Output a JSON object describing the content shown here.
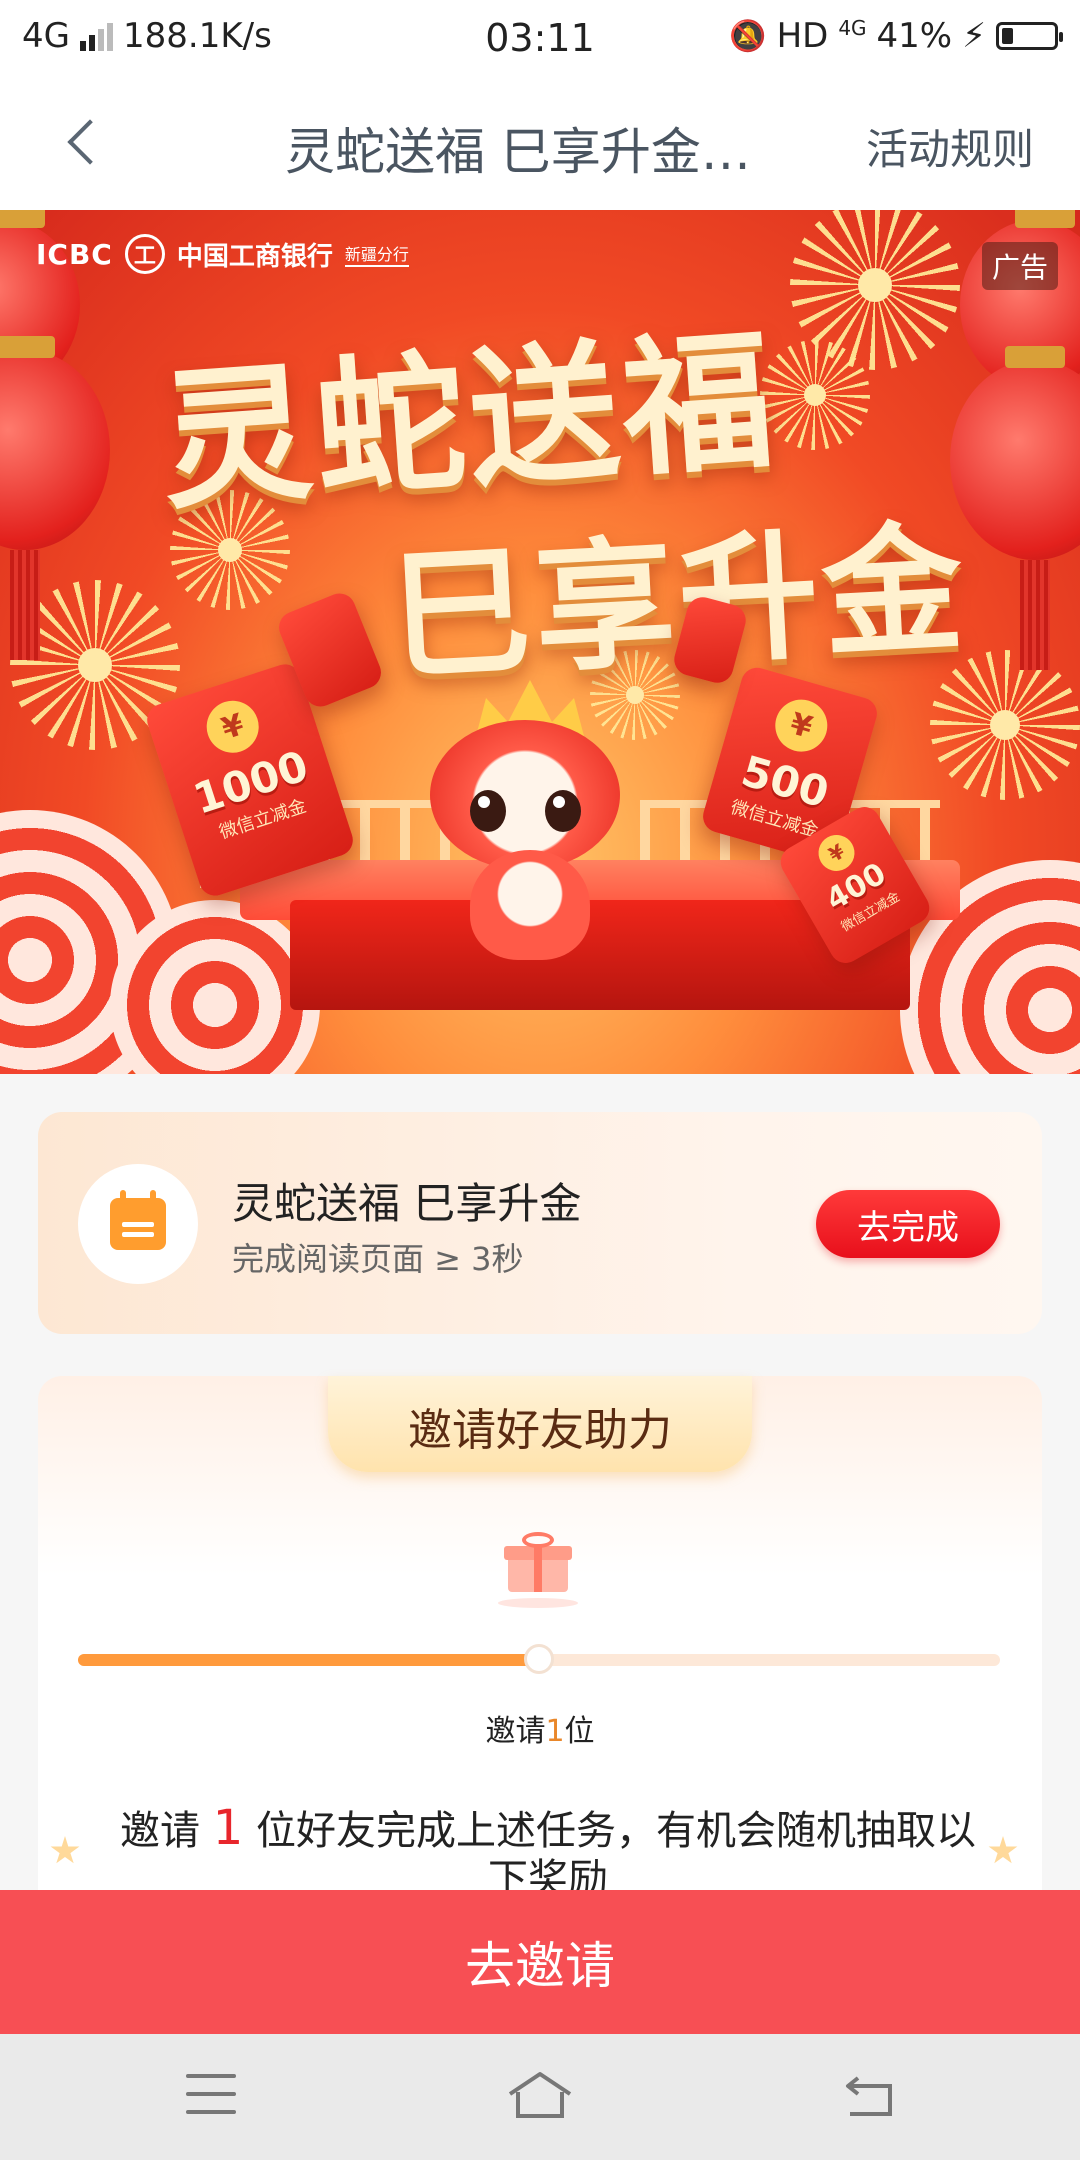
{
  "status_bar": {
    "network": "4G",
    "speed": "188.1K/s",
    "time": "03:11",
    "hd": "HD",
    "net2": "4G",
    "battery": "41%",
    "battery_level": 0.41
  },
  "nav": {
    "title": "灵蛇送福 巳享升金…",
    "rules_label": "活动规则",
    "back_icon": "chevron-left-icon"
  },
  "banner": {
    "bank_abbr": "ICBC",
    "bank_mark": "工",
    "bank_name": "中国工商银行",
    "bank_branch": "新疆分行",
    "ad_tag": "广告",
    "headline_line1": "灵蛇送福",
    "headline_line2": "巳享升金",
    "envelopes": [
      {
        "amount": "1000",
        "label": "微信立减金"
      },
      {
        "amount": "500",
        "label": "微信立减金"
      },
      {
        "amount": "400",
        "label": "微信立减金"
      }
    ],
    "coin_symbol": "¥"
  },
  "task": {
    "icon": "calendar-icon",
    "title": "灵蛇送福 巳享升金",
    "desc": "完成阅读页面 ≥ 3秒",
    "button": "去完成"
  },
  "invite": {
    "header": "邀请好友助力",
    "gift_icon": "gift-icon",
    "progress": 0.5,
    "progress_label_prefix": "邀请",
    "progress_label_num": "1",
    "progress_label_suffix": "位",
    "desc_prefix": "邀请",
    "desc_num": "1",
    "desc_suffix": "位好友完成上述任务，有机会随机抽取以下奖励"
  },
  "bottom_button": "去邀请",
  "system_nav": [
    "menu-icon",
    "home-icon",
    "back-icon"
  ],
  "colors": {
    "accent_red": "#f74f54",
    "button_red": "#e80f1b",
    "progress_orange": "#ff9a3c"
  }
}
